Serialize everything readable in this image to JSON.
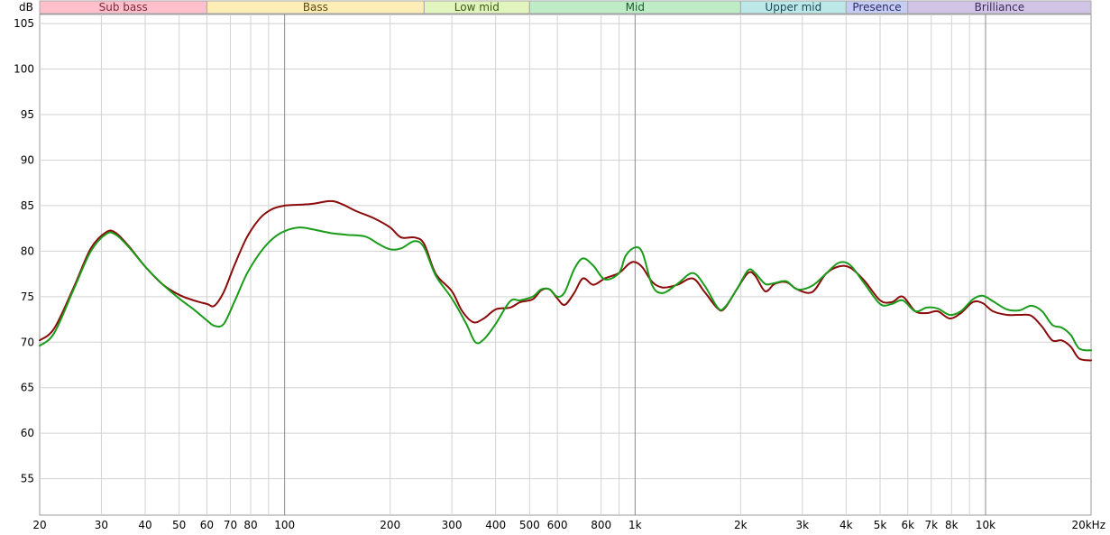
{
  "chart_data": {
    "type": "line",
    "title": "",
    "xlabel": "",
    "ylabel": "dB",
    "x_scale": "log",
    "xlim": [
      20,
      20000
    ],
    "ylim": [
      51,
      106
    ],
    "grid": true,
    "x_ticks": [
      {
        "value": 20,
        "label": "20"
      },
      {
        "value": 30,
        "label": "30"
      },
      {
        "value": 40,
        "label": "40"
      },
      {
        "value": 50,
        "label": "50"
      },
      {
        "value": 60,
        "label": "60"
      },
      {
        "value": 70,
        "label": "70"
      },
      {
        "value": 80,
        "label": "80"
      },
      {
        "value": 100,
        "label": "100"
      },
      {
        "value": 200,
        "label": "200"
      },
      {
        "value": 300,
        "label": "300"
      },
      {
        "value": 400,
        "label": "400"
      },
      {
        "value": 500,
        "label": "500"
      },
      {
        "value": 600,
        "label": "600"
      },
      {
        "value": 800,
        "label": "800"
      },
      {
        "value": 1000,
        "label": "1k"
      },
      {
        "value": 2000,
        "label": "2k"
      },
      {
        "value": 3000,
        "label": "3k"
      },
      {
        "value": 4000,
        "label": "4k"
      },
      {
        "value": 5000,
        "label": "5k"
      },
      {
        "value": 6000,
        "label": "6k"
      },
      {
        "value": 7000,
        "label": "7k"
      },
      {
        "value": 8000,
        "label": "8k"
      },
      {
        "value": 10000,
        "label": "10k"
      },
      {
        "value": 20000,
        "label": "20kHz"
      }
    ],
    "x_minor_grid": [
      90,
      900,
      9000
    ],
    "x_major_grid": [
      100,
      1000,
      10000
    ],
    "y_ticks": [
      55,
      60,
      65,
      70,
      75,
      80,
      85,
      90,
      95,
      100,
      105
    ],
    "bands": [
      {
        "label": "Sub bass",
        "from": 20,
        "to": 60,
        "color": "#ffc0cb",
        "text_color": "#7a2a3a"
      },
      {
        "label": "Bass",
        "from": 60,
        "to": 250,
        "color": "#ffedb8",
        "text_color": "#5a4a10"
      },
      {
        "label": "Low mid",
        "from": 250,
        "to": 500,
        "color": "#e2f4bd",
        "text_color": "#3a5a10"
      },
      {
        "label": "Mid",
        "from": 500,
        "to": 2000,
        "color": "#bdecc7",
        "text_color": "#1a5a2a"
      },
      {
        "label": "Upper mid",
        "from": 2000,
        "to": 4000,
        "color": "#bde8e8",
        "text_color": "#1a4a5a"
      },
      {
        "label": "Presence",
        "from": 4000,
        "to": 6000,
        "color": "#c6cdf2",
        "text_color": "#2a2a6a"
      },
      {
        "label": "Brilliance",
        "from": 6000,
        "to": 20000,
        "color": "#d2c4e6",
        "text_color": "#3a2a5a"
      }
    ],
    "series": [
      {
        "color": "#8b0a0a",
        "points": [
          [
            20,
            70.2
          ],
          [
            22,
            71.5
          ],
          [
            25,
            76
          ],
          [
            28,
            80.3
          ],
          [
            31,
            82.1
          ],
          [
            33,
            82
          ],
          [
            36,
            80.5
          ],
          [
            40,
            78.3
          ],
          [
            45,
            76.3
          ],
          [
            50,
            75.2
          ],
          [
            55,
            74.6
          ],
          [
            60,
            74.2
          ],
          [
            63,
            74
          ],
          [
            67,
            75.5
          ],
          [
            72,
            78.5
          ],
          [
            78,
            81.5
          ],
          [
            85,
            83.6
          ],
          [
            92,
            84.6
          ],
          [
            100,
            85
          ],
          [
            110,
            85.1
          ],
          [
            120,
            85.2
          ],
          [
            135,
            85.5
          ],
          [
            145,
            85.2
          ],
          [
            160,
            84.4
          ],
          [
            180,
            83.6
          ],
          [
            200,
            82.6
          ],
          [
            215,
            81.5
          ],
          [
            235,
            81.5
          ],
          [
            250,
            80.8
          ],
          [
            270,
            77.5
          ],
          [
            300,
            75.6
          ],
          [
            320,
            73.5
          ],
          [
            345,
            72.2
          ],
          [
            370,
            72.6
          ],
          [
            400,
            73.6
          ],
          [
            440,
            73.8
          ],
          [
            470,
            74.4
          ],
          [
            510,
            74.7
          ],
          [
            540,
            75.7
          ],
          [
            570,
            75.8
          ],
          [
            600,
            74.8
          ],
          [
            630,
            74.1
          ],
          [
            670,
            75.4
          ],
          [
            710,
            77
          ],
          [
            760,
            76.3
          ],
          [
            820,
            77
          ],
          [
            900,
            77.6
          ],
          [
            960,
            78.6
          ],
          [
            1000,
            78.8
          ],
          [
            1050,
            78.2
          ],
          [
            1120,
            76.6
          ],
          [
            1200,
            76
          ],
          [
            1320,
            76.3
          ],
          [
            1460,
            77
          ],
          [
            1580,
            75.5
          ],
          [
            1720,
            73.7
          ],
          [
            1800,
            73.7
          ],
          [
            1950,
            75.8
          ],
          [
            2100,
            77.6
          ],
          [
            2200,
            77.3
          ],
          [
            2350,
            75.6
          ],
          [
            2500,
            76.4
          ],
          [
            2700,
            76.6
          ],
          [
            2900,
            75.8
          ],
          [
            3200,
            75.5
          ],
          [
            3500,
            77.5
          ],
          [
            3800,
            78.3
          ],
          [
            4100,
            78.2
          ],
          [
            4500,
            76.8
          ],
          [
            5000,
            74.6
          ],
          [
            5400,
            74.4
          ],
          [
            5800,
            75
          ],
          [
            6300,
            73.4
          ],
          [
            6800,
            73.2
          ],
          [
            7300,
            73.4
          ],
          [
            7900,
            72.6
          ],
          [
            8500,
            73.2
          ],
          [
            9200,
            74.4
          ],
          [
            9800,
            74.3
          ],
          [
            10500,
            73.4
          ],
          [
            11500,
            73
          ],
          [
            12500,
            73
          ],
          [
            13500,
            72.9
          ],
          [
            14500,
            71.7
          ],
          [
            15500,
            70.2
          ],
          [
            16500,
            70.2
          ],
          [
            17500,
            69.5
          ],
          [
            18500,
            68.2
          ],
          [
            20000,
            68
          ]
        ]
      },
      {
        "color": "#1a9c1a",
        "points": [
          [
            20,
            69.6
          ],
          [
            22,
            71
          ],
          [
            25,
            75.8
          ],
          [
            28,
            80
          ],
          [
            31,
            81.9
          ],
          [
            33,
            81.8
          ],
          [
            36,
            80.4
          ],
          [
            40,
            78.3
          ],
          [
            45,
            76.3
          ],
          [
            50,
            74.8
          ],
          [
            55,
            73.6
          ],
          [
            60,
            72.4
          ],
          [
            63,
            71.8
          ],
          [
            67,
            72
          ],
          [
            72,
            74.5
          ],
          [
            78,
            77.5
          ],
          [
            85,
            79.8
          ],
          [
            92,
            81.3
          ],
          [
            100,
            82.2
          ],
          [
            110,
            82.6
          ],
          [
            120,
            82.4
          ],
          [
            135,
            82
          ],
          [
            150,
            81.8
          ],
          [
            170,
            81.6
          ],
          [
            185,
            80.8
          ],
          [
            200,
            80.2
          ],
          [
            215,
            80.3
          ],
          [
            235,
            81.1
          ],
          [
            250,
            80.4
          ],
          [
            270,
            77.3
          ],
          [
            300,
            74.8
          ],
          [
            330,
            72
          ],
          [
            350,
            70
          ],
          [
            370,
            70.3
          ],
          [
            400,
            72
          ],
          [
            440,
            74.5
          ],
          [
            470,
            74.6
          ],
          [
            510,
            75
          ],
          [
            540,
            75.8
          ],
          [
            570,
            75.8
          ],
          [
            600,
            75
          ],
          [
            630,
            75.5
          ],
          [
            670,
            78
          ],
          [
            710,
            79.2
          ],
          [
            760,
            78.4
          ],
          [
            820,
            76.9
          ],
          [
            900,
            77.6
          ],
          [
            940,
            79.5
          ],
          [
            1000,
            80.4
          ],
          [
            1050,
            79.8
          ],
          [
            1120,
            76.2
          ],
          [
            1200,
            75.4
          ],
          [
            1320,
            76.4
          ],
          [
            1460,
            77.6
          ],
          [
            1580,
            76.2
          ],
          [
            1720,
            73.8
          ],
          [
            1800,
            73.8
          ],
          [
            1950,
            75.8
          ],
          [
            2100,
            77.9
          ],
          [
            2200,
            77.6
          ],
          [
            2350,
            76.4
          ],
          [
            2500,
            76.5
          ],
          [
            2700,
            76.7
          ],
          [
            2900,
            75.8
          ],
          [
            3200,
            76.2
          ],
          [
            3500,
            77.5
          ],
          [
            3800,
            78.7
          ],
          [
            4100,
            78.5
          ],
          [
            4500,
            76.5
          ],
          [
            5000,
            74.2
          ],
          [
            5400,
            74.2
          ],
          [
            5800,
            74.6
          ],
          [
            6300,
            73.4
          ],
          [
            6800,
            73.8
          ],
          [
            7300,
            73.7
          ],
          [
            7900,
            73
          ],
          [
            8500,
            73.4
          ],
          [
            9200,
            74.7
          ],
          [
            9800,
            75.1
          ],
          [
            10500,
            74.5
          ],
          [
            11500,
            73.6
          ],
          [
            12500,
            73.5
          ],
          [
            13500,
            74
          ],
          [
            14500,
            73.4
          ],
          [
            15500,
            71.9
          ],
          [
            16500,
            71.6
          ],
          [
            17500,
            70.8
          ],
          [
            18500,
            69.3
          ],
          [
            20000,
            69.1
          ]
        ]
      }
    ]
  }
}
